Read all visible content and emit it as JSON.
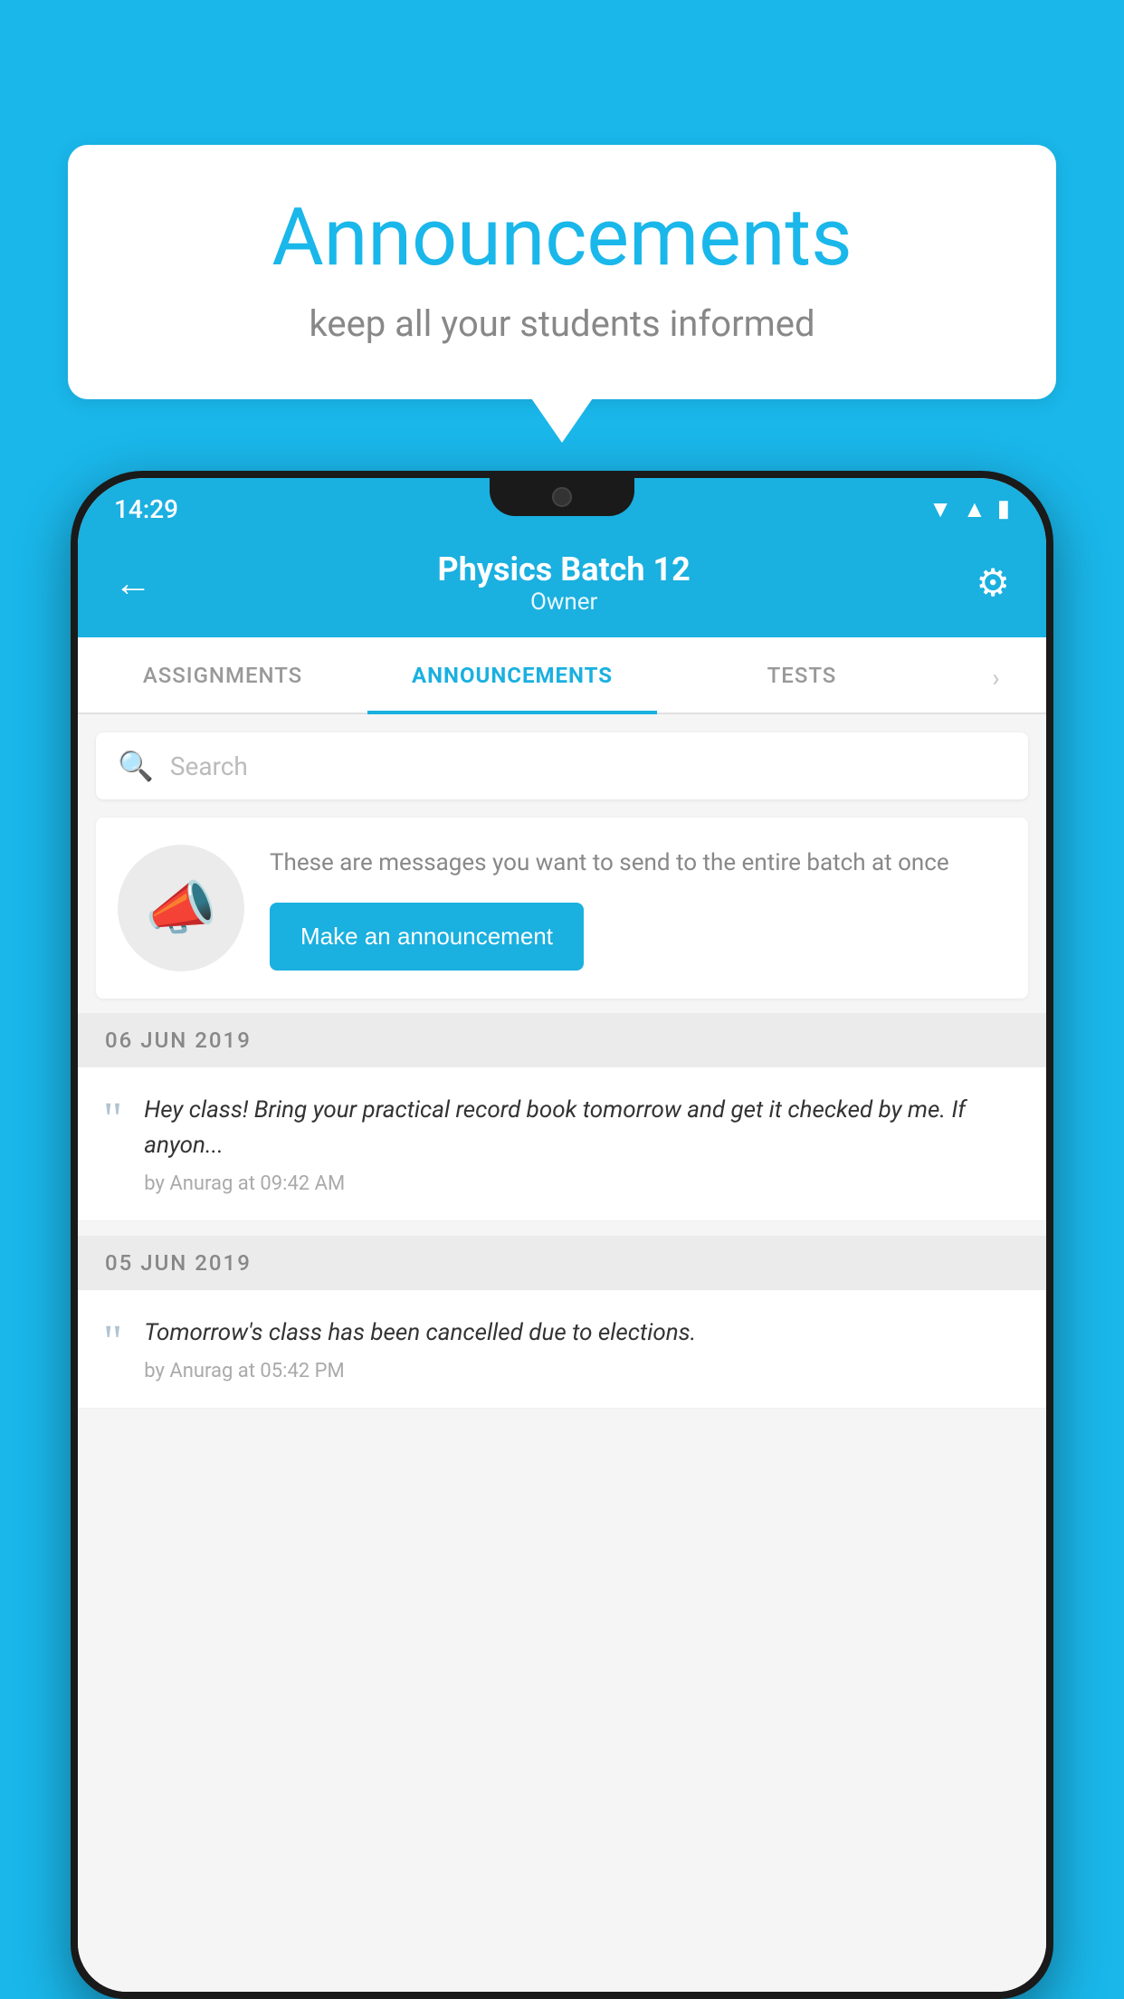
{
  "background_color": "#1ab7ea",
  "speech_bubble": {
    "title": "Announcements",
    "subtitle": "keep all your students informed"
  },
  "status_bar": {
    "time": "14:29",
    "icons": [
      "wifi",
      "signal",
      "battery"
    ]
  },
  "header": {
    "title": "Physics Batch 12",
    "subtitle": "Owner",
    "back_label": "←",
    "settings_label": "⚙"
  },
  "tabs": [
    {
      "label": "ASSIGNMENTS",
      "active": false
    },
    {
      "label": "ANNOUNCEMENTS",
      "active": true
    },
    {
      "label": "TESTS",
      "active": false
    },
    {
      "label": "•",
      "active": false
    }
  ],
  "search": {
    "placeholder": "Search"
  },
  "announce_prompt": {
    "description": "These are messages you want to send to the entire batch at once",
    "button_label": "Make an announcement"
  },
  "date_sections": [
    {
      "date": "06  JUN  2019",
      "items": [
        {
          "message": "Hey class! Bring your practical record book tomorrow and get it checked by me. If anyon...",
          "meta": "by Anurag at 09:42 AM"
        }
      ]
    },
    {
      "date": "05  JUN  2019",
      "items": [
        {
          "message": "Tomorrow's class has been cancelled due to elections.",
          "meta": "by Anurag at 05:42 PM"
        }
      ]
    }
  ],
  "icons": {
    "back": "←",
    "settings": "⚙",
    "search": "🔍",
    "megaphone": "📣",
    "quote": "“"
  }
}
